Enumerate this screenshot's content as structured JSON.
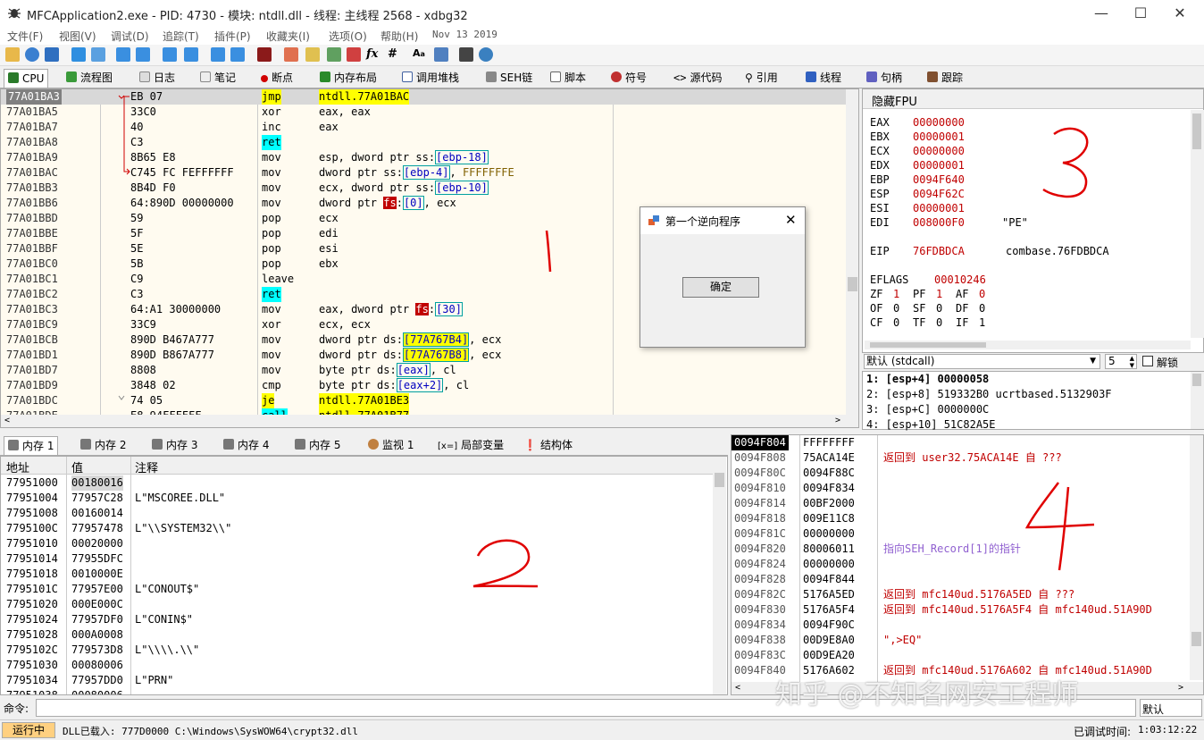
{
  "window": {
    "title": "MFCApplication2.exe - PID: 4730 - 模块: ntdll.dll - 线程: 主线程 2568 - xdbg32"
  },
  "menu": [
    "文件(F)",
    "视图(V)",
    "调试(D)",
    "追踪(T)",
    "插件(P)",
    "收藏夹(I)",
    "选项(O)",
    "帮助(H)",
    "Nov 13 2019"
  ],
  "tabs": [
    "CPU",
    "流程图",
    "日志",
    "笔记",
    "断点",
    "内存布局",
    "调用堆栈",
    "SEH链",
    "脚本",
    "符号",
    "源代码",
    "引用",
    "线程",
    "句柄",
    "跟踪"
  ],
  "disasm": [
    {
      "addr": "77A01BA3",
      "bytes": "EB 07",
      "mnem": "jmp",
      "ops": "ntdll.77A01BAC"
    },
    {
      "addr": "77A01BA5",
      "bytes": "33C0",
      "mnem": "xor",
      "ops": "eax, eax"
    },
    {
      "addr": "77A01BA7",
      "bytes": "40",
      "mnem": "inc",
      "ops": "eax"
    },
    {
      "addr": "77A01BA8",
      "bytes": "C3",
      "mnem": "ret",
      "ops": ""
    },
    {
      "addr": "77A01BA9",
      "bytes": "8B65 E8",
      "mnem": "mov",
      "ops": "esp, dword ptr ss:[ebp-18]"
    },
    {
      "addr": "77A01BAC",
      "bytes": "C745 FC FEFFFFFF",
      "mnem": "mov",
      "ops": "dword ptr ss:[ebp-4], FFFFFFFE"
    },
    {
      "addr": "77A01BB3",
      "bytes": "8B4D F0",
      "mnem": "mov",
      "ops": "ecx, dword ptr ss:[ebp-10]"
    },
    {
      "addr": "77A01BB6",
      "bytes": "64:890D 00000000",
      "mnem": "mov",
      "ops": "dword ptr fs:[0], ecx"
    },
    {
      "addr": "77A01BBD",
      "bytes": "59",
      "mnem": "pop",
      "ops": "ecx"
    },
    {
      "addr": "77A01BBE",
      "bytes": "5F",
      "mnem": "pop",
      "ops": "edi"
    },
    {
      "addr": "77A01BBF",
      "bytes": "5E",
      "mnem": "pop",
      "ops": "esi"
    },
    {
      "addr": "77A01BC0",
      "bytes": "5B",
      "mnem": "pop",
      "ops": "ebx"
    },
    {
      "addr": "77A01BC1",
      "bytes": "C9",
      "mnem": "leave",
      "ops": ""
    },
    {
      "addr": "77A01BC2",
      "bytes": "C3",
      "mnem": "ret",
      "ops": ""
    },
    {
      "addr": "77A01BC3",
      "bytes": "64:A1 30000000",
      "mnem": "mov",
      "ops": "eax, dword ptr fs:[30]"
    },
    {
      "addr": "77A01BC9",
      "bytes": "33C9",
      "mnem": "xor",
      "ops": "ecx, ecx"
    },
    {
      "addr": "77A01BCB",
      "bytes": "890D B467A777",
      "mnem": "mov",
      "ops": "dword ptr ds:[77A767B4], ecx"
    },
    {
      "addr": "77A01BD1",
      "bytes": "890D B867A777",
      "mnem": "mov",
      "ops": "dword ptr ds:[77A767B8], ecx"
    },
    {
      "addr": "77A01BD7",
      "bytes": "8808",
      "mnem": "mov",
      "ops": "byte ptr ds:[eax], cl"
    },
    {
      "addr": "77A01BD9",
      "bytes": "3848 02",
      "mnem": "cmp",
      "ops": "byte ptr ds:[eax+2], cl"
    },
    {
      "addr": "77A01BDC",
      "bytes": "74 05",
      "mnem": "je",
      "ops": "ntdll.77A01BE3"
    },
    {
      "addr": "77A01BDE",
      "bytes": "E8 94FFFFFF",
      "mnem": "call",
      "ops": "ntdll.77A01B77"
    }
  ],
  "regs": {
    "header": "隐藏FPU",
    "gp": [
      {
        "n": "EAX",
        "v": "00000000",
        "c": ""
      },
      {
        "n": "EBX",
        "v": "00000001",
        "c": ""
      },
      {
        "n": "ECX",
        "v": "00000000",
        "c": ""
      },
      {
        "n": "EDX",
        "v": "00000001",
        "c": ""
      },
      {
        "n": "EBP",
        "v": "0094F640",
        "c": ""
      },
      {
        "n": "ESP",
        "v": "0094F62C",
        "c": ""
      },
      {
        "n": "ESI",
        "v": "00000001",
        "c": ""
      },
      {
        "n": "EDI",
        "v": "008000F0",
        "c": "\"PE\""
      }
    ],
    "eip": {
      "n": "EIP",
      "v": "76FDBDCA",
      "c": "combase.76FDBDCA"
    },
    "eflags": {
      "n": "EFLAGS",
      "v": "00010246"
    },
    "flags": [
      [
        "ZF",
        "1",
        "PF",
        "1",
        "AF",
        "0"
      ],
      [
        "OF",
        "0",
        "SF",
        "0",
        "DF",
        "0"
      ],
      [
        "CF",
        "0",
        "TF",
        "0",
        "IF",
        "1"
      ]
    ]
  },
  "callconv": {
    "label": "默认 (stdcall)",
    "count": "5",
    "unlock": "解锁"
  },
  "stackargs": [
    "1: [esp+4] 00000058",
    "2: [esp+8] 519332B0 ucrtbased.5132903F",
    "3: [esp+C] 0000000C",
    "4: [esp+10] 51C82A5E"
  ],
  "dialog": {
    "title": "第一个逆向程序",
    "ok": "确定"
  },
  "btabs": [
    "内存 1",
    "内存 2",
    "内存 3",
    "内存 4",
    "内存 5",
    "监视 1",
    "局部变量",
    "结构体"
  ],
  "dump": {
    "headers": [
      "地址",
      "值",
      "注释"
    ],
    "rows": [
      {
        "a": "77951000",
        "v": "00180016",
        "c": ""
      },
      {
        "a": "77951004",
        "v": "77957C28",
        "c": "L\"MSCOREE.DLL\""
      },
      {
        "a": "77951008",
        "v": "00160014",
        "c": ""
      },
      {
        "a": "7795100C",
        "v": "77957478",
        "c": "L\"\\\\SYSTEM32\\\\\""
      },
      {
        "a": "77951010",
        "v": "00020000",
        "c": ""
      },
      {
        "a": "77951014",
        "v": "77955DFC",
        "c": ""
      },
      {
        "a": "77951018",
        "v": "0010000E",
        "c": ""
      },
      {
        "a": "7795101C",
        "v": "77957E00",
        "c": "L\"CONOUT$\""
      },
      {
        "a": "77951020",
        "v": "000E000C",
        "c": ""
      },
      {
        "a": "77951024",
        "v": "77957DF0",
        "c": "L\"CONIN$\""
      },
      {
        "a": "77951028",
        "v": "000A0008",
        "c": ""
      },
      {
        "a": "7795102C",
        "v": "779573D8",
        "c": "L\"\\\\\\\\.\\\\\""
      },
      {
        "a": "77951030",
        "v": "00080006",
        "c": ""
      },
      {
        "a": "77951034",
        "v": "77957DD0",
        "c": "L\"PRN\""
      },
      {
        "a": "77951038",
        "v": "00080006",
        "c": ""
      }
    ]
  },
  "stack": [
    {
      "a": "0094F804",
      "v": "FFFFFFFF",
      "c": ""
    },
    {
      "a": "0094F808",
      "v": "75ACA14E",
      "c": "返回到 user32.75ACA14E 自 ???"
    },
    {
      "a": "0094F80C",
      "v": "0094F88C",
      "c": ""
    },
    {
      "a": "0094F810",
      "v": "0094F834",
      "c": ""
    },
    {
      "a": "0094F814",
      "v": "00BF2000",
      "c": ""
    },
    {
      "a": "0094F818",
      "v": "009E11C8",
      "c": ""
    },
    {
      "a": "0094F81C",
      "v": "00000000",
      "c": ""
    },
    {
      "a": "0094F820",
      "v": "80006011",
      "c": "指向SEH_Record[1]的指针"
    },
    {
      "a": "0094F824",
      "v": "00000000",
      "c": ""
    },
    {
      "a": "0094F828",
      "v": "0094F844",
      "c": ""
    },
    {
      "a": "0094F82C",
      "v": "5176A5ED",
      "c": "返回到 mfc140ud.5176A5ED 自 ???"
    },
    {
      "a": "0094F830",
      "v": "5176A5F4",
      "c": "返回到 mfc140ud.5176A5F4 自 mfc140ud.51A90D"
    },
    {
      "a": "0094F834",
      "v": "0094F90C",
      "c": ""
    },
    {
      "a": "0094F838",
      "v": "00D9E8A0",
      "c": "\",>EQ\""
    },
    {
      "a": "0094F83C",
      "v": "00D9EA20",
      "c": ""
    },
    {
      "a": "0094F840",
      "v": "5176A602",
      "c": "返回到 mfc140ud.5176A602 自 mfc140ud.51A90D"
    }
  ],
  "cmd": {
    "label": "命令:",
    "mode": "默认"
  },
  "status": {
    "state": "运行中",
    "msg": "DLL已载入: 777D0000 C:\\Windows\\SysWOW64\\crypt32.dll",
    "elapsed_label": "已调试时间:",
    "elapsed": "1:03:12:22"
  },
  "watermark": "知乎 @不知名网安工程师",
  "annotations": [
    "1",
    "2",
    "3",
    "4"
  ]
}
